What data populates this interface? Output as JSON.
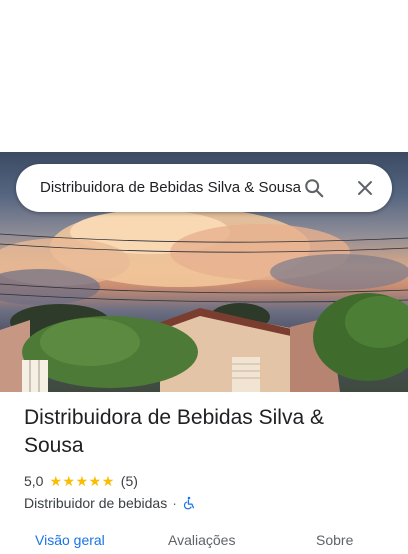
{
  "search": {
    "query": "Distribuidora de Bebidas Silva & Sousa",
    "search_icon": "search-icon",
    "close_icon": "close-icon"
  },
  "place": {
    "title": "Distribuidora de Bebidas Silva & Sousa",
    "rating": "5,0",
    "stars": 5,
    "review_count": "(5)",
    "category": "Distribuidor de bebidas",
    "separator": "·",
    "accessibility_icon": "wheelchair-icon"
  },
  "tabs": [
    {
      "label": "Visão geral"
    },
    {
      "label": "Avaliações"
    },
    {
      "label": "Sobre"
    }
  ],
  "colors": {
    "accent": "#1a73e8",
    "star": "#fbbc04",
    "text": "#202124"
  }
}
